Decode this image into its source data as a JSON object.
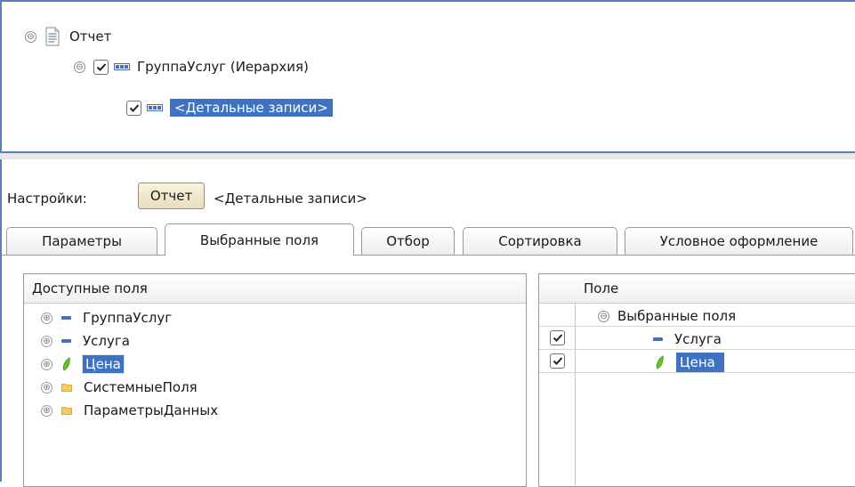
{
  "structure_tree": {
    "root": {
      "label": "Отчет",
      "collapse_glyph": "⊖",
      "icon": "document-icon"
    },
    "group": {
      "label": "ГруппаУслуг (Иерархия)",
      "collapse_glyph": "⊖",
      "checked": true,
      "icon": "grouping-icon"
    },
    "detail": {
      "label": "<Детальные записи>",
      "checked": true,
      "selected": true,
      "icon": "grouping-icon"
    }
  },
  "settings": {
    "label": "Настройки:",
    "context_buttons": [
      "Отчет",
      "<Детальные записи>"
    ]
  },
  "tabs": [
    {
      "label": "Параметры",
      "active": false
    },
    {
      "label": "Выбранные поля",
      "active": true
    },
    {
      "label": "Отбор",
      "active": false
    },
    {
      "label": "Сортировка",
      "active": false
    },
    {
      "label": "Условное оформление",
      "active": false
    }
  ],
  "available_fields": {
    "header": "Доступные поля",
    "items": [
      {
        "label": "ГруппаУслуг",
        "expand_glyph": "⊕",
        "icon": "dimension-icon"
      },
      {
        "label": "Услуга",
        "expand_glyph": "⊕",
        "icon": "dimension-icon"
      },
      {
        "label": "Цена",
        "expand_glyph": "⊕",
        "icon": "resource-icon",
        "selected": true
      },
      {
        "label": "СистемныеПоля",
        "expand_glyph": "⊕",
        "icon": "folder-icon"
      },
      {
        "label": "ПараметрыДанных",
        "expand_glyph": "⊕",
        "icon": "folder-icon"
      }
    ]
  },
  "selected_fields": {
    "header": "Поле",
    "rows": [
      {
        "label": "Выбранные поля",
        "collapse_glyph": "⊖",
        "checked": null
      },
      {
        "label": "Услуга",
        "icon": "dimension-icon",
        "checked": true
      },
      {
        "label": "Цена",
        "icon": "resource-icon",
        "checked": true,
        "selected": true
      }
    ]
  },
  "colors": {
    "selection": "#3e73c4",
    "panel_border": "#5b7fb8",
    "dimension_icon": "#4b6fb6",
    "resource_icon": "#69c22b",
    "folder_icon": "#f0c64a"
  }
}
